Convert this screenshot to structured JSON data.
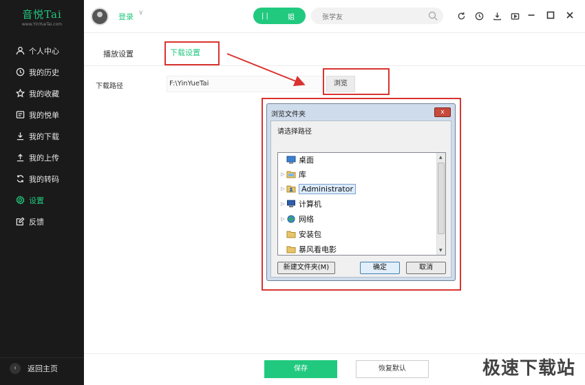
{
  "app": {
    "logo_text": "音悦Tai",
    "logo_url": "www.YinYueTai.com"
  },
  "sidebar": {
    "items": [
      {
        "label": "个人中心",
        "icon": "user-icon"
      },
      {
        "label": "我的历史",
        "icon": "clock-icon"
      },
      {
        "label": "我的收藏",
        "icon": "star-icon"
      },
      {
        "label": "我的悦单",
        "icon": "playlist-icon"
      },
      {
        "label": "我的下载",
        "icon": "download-icon"
      },
      {
        "label": "我的上传",
        "icon": "upload-icon"
      },
      {
        "label": "我的转码",
        "icon": "convert-icon"
      },
      {
        "label": "设置",
        "icon": "gear-icon",
        "active": true
      },
      {
        "label": "反馈",
        "icon": "feedback-icon"
      }
    ],
    "back_label": "返回主页"
  },
  "topbar": {
    "login_label": "登录",
    "toggle_left": "| |",
    "toggle_right": "姐",
    "search_value": "张学友"
  },
  "settings": {
    "tab_play": "播放设置",
    "tab_download": "下载设置",
    "path_label": "下载路径",
    "path_value": "F:\\YinYueTai",
    "browse_label": "浏览"
  },
  "dialog": {
    "title": "浏览文件夹",
    "close_label": "x",
    "prompt": "请选择路径",
    "tree": [
      {
        "label": "桌面",
        "icon": "desktop-icon",
        "expander": ""
      },
      {
        "label": "库",
        "icon": "library-icon",
        "expander": "▷"
      },
      {
        "label": "Administrator",
        "icon": "user-folder-icon",
        "expander": "▷",
        "selected": true
      },
      {
        "label": "计算机",
        "icon": "computer-icon",
        "expander": "▷"
      },
      {
        "label": "网络",
        "icon": "network-icon",
        "expander": "▷"
      },
      {
        "label": "安装包",
        "icon": "folder-icon",
        "expander": ""
      },
      {
        "label": "暴风看电影",
        "icon": "folder-icon",
        "expander": ""
      }
    ],
    "new_folder_label": "新建文件夹(M)",
    "ok_label": "确定",
    "cancel_label": "取消"
  },
  "footer": {
    "save_label": "保存",
    "reset_label": "恢复默认"
  },
  "watermark": "极速下载站",
  "colors": {
    "accent": "#21c97f",
    "sidebar_bg": "#1a1a1a",
    "annotation_red": "#d9322e"
  }
}
